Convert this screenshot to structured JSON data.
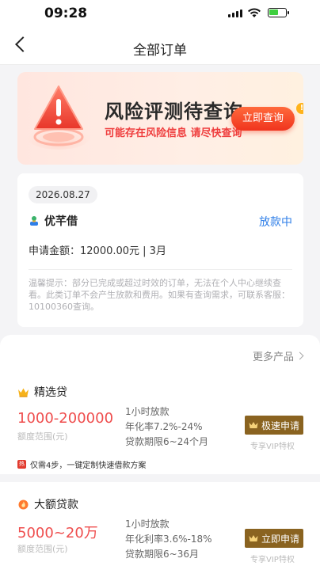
{
  "status_bar": {
    "time": "09:28",
    "battery_fraction": 0.55
  },
  "nav": {
    "title": "全部订单"
  },
  "banner": {
    "title": "风险评测待查询",
    "subtitle": "可能存在风险信息 请尽快查询",
    "button_label": "立即查询",
    "badge": "!"
  },
  "order": {
    "date": "2026.08.27",
    "brand": "优芊借",
    "status": "放款中",
    "amount_line": "申请金额：12000.00元 | 3月",
    "tip": "温馨提示：部分已完成或超过时效的订单，无法在个人中心继续查看。此类订单不会产生放款和费用。如果有查询需求，可联系客服：10100360查询。"
  },
  "products": {
    "more_label": "更多产品",
    "items": [
      {
        "name": "精选贷",
        "range": "1000-200000",
        "range_label": "额度范围(元)",
        "features": [
          "1小时放款",
          "年化率7.2%-24%",
          "贷款期限6~24个月"
        ],
        "button_label": "极速申请",
        "vip_label": "专享VIP特权"
      },
      {
        "name": "大额贷款",
        "range": "5000~20万",
        "range_label": "额度范围(元)",
        "features": [
          "1小时放款",
          "年化利率3.6%-18%",
          "贷款期限6~36月"
        ],
        "button_label": "立即申请",
        "vip_label": "专享VIP特权"
      }
    ],
    "promo": {
      "badge": "热",
      "text": "仅需4步，一键定制快速借款方案"
    }
  },
  "colors": {
    "accent_red": "#ef4d4d",
    "link_blue": "#2f7fe8",
    "gold": "#8a6320"
  }
}
